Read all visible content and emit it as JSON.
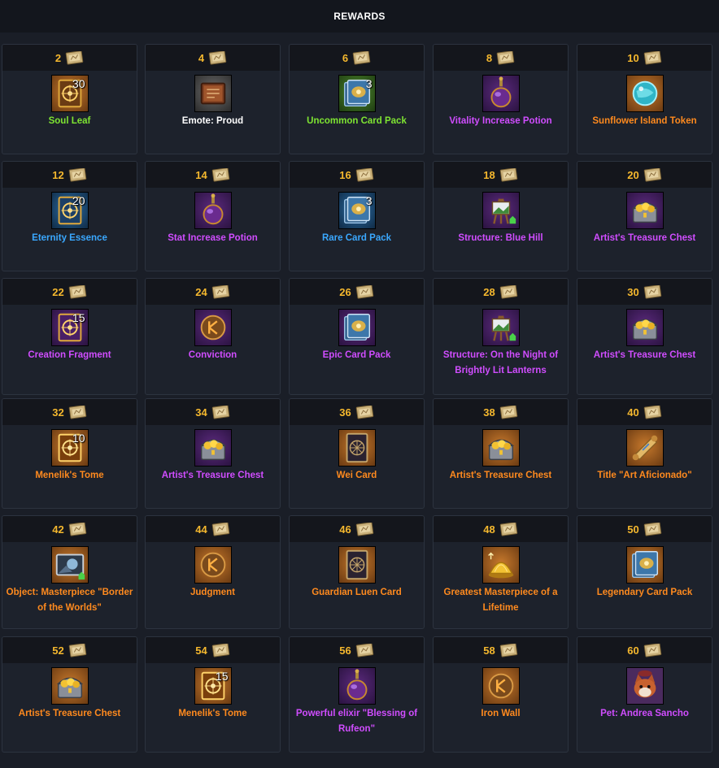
{
  "header": {
    "title": "REWARDS"
  },
  "rewards": [
    {
      "level": "2",
      "qty": "30",
      "label": "Soul Leaf",
      "quality": "green",
      "icon": "soul-leaf-icon"
    },
    {
      "level": "4",
      "qty": "",
      "label": "Emote: Proud",
      "quality": "white",
      "icon": "emote-book-icon"
    },
    {
      "level": "6",
      "qty": "3",
      "label": "Uncommon Card Pack",
      "quality": "green",
      "icon": "card-pack-icon"
    },
    {
      "level": "8",
      "qty": "",
      "label": "Vitality Increase Potion",
      "quality": "purple",
      "icon": "potion-icon"
    },
    {
      "level": "10",
      "qty": "",
      "label": "Sunflower Island Token",
      "quality": "orange",
      "icon": "token-orb-icon"
    },
    {
      "level": "12",
      "qty": "20",
      "label": "Eternity Essence",
      "quality": "blue",
      "icon": "essence-card-icon"
    },
    {
      "level": "14",
      "qty": "",
      "label": "Stat Increase Potion",
      "quality": "purple",
      "icon": "potion-icon"
    },
    {
      "level": "16",
      "qty": "3",
      "label": "Rare Card Pack",
      "quality": "blue",
      "icon": "card-pack-icon"
    },
    {
      "level": "18",
      "qty": "",
      "label": "Structure: Blue Hill",
      "quality": "purple",
      "icon": "easel-icon"
    },
    {
      "level": "20",
      "qty": "",
      "label": "Artist's Treasure Chest",
      "quality": "purple",
      "icon": "treasure-chest-icon"
    },
    {
      "level": "22",
      "qty": "15",
      "label": "Creation Fragment",
      "quality": "purple",
      "icon": "fragment-card-icon"
    },
    {
      "level": "24",
      "qty": "",
      "label": "Conviction",
      "quality": "purple",
      "icon": "rune-icon"
    },
    {
      "level": "26",
      "qty": "",
      "label": "Epic Card Pack",
      "quality": "purple",
      "icon": "card-pack-icon"
    },
    {
      "level": "28",
      "qty": "",
      "label": "Structure: On the Night of Brightly Lit Lanterns",
      "quality": "purple",
      "icon": "easel-icon"
    },
    {
      "level": "30",
      "qty": "",
      "label": "Artist's Treasure Chest",
      "quality": "purple",
      "icon": "treasure-chest-icon"
    },
    {
      "level": "32",
      "qty": "10",
      "label": "Menelik's Tome",
      "quality": "orange",
      "icon": "tome-icon"
    },
    {
      "level": "34",
      "qty": "",
      "label": "Artist's Treasure Chest",
      "quality": "purple",
      "icon": "treasure-chest-icon"
    },
    {
      "level": "36",
      "qty": "",
      "label": "Wei Card",
      "quality": "orange",
      "icon": "tarot-card-icon"
    },
    {
      "level": "38",
      "qty": "",
      "label": "Artist's Treasure Chest",
      "quality": "orange",
      "icon": "treasure-chest-icon"
    },
    {
      "level": "40",
      "qty": "",
      "label": "Title \"Art Aficionado\"",
      "quality": "orange",
      "icon": "scroll-icon"
    },
    {
      "level": "42",
      "qty": "",
      "label": "Object: Masterpiece \"Border of the Worlds\"",
      "quality": "orange",
      "icon": "painting-icon"
    },
    {
      "level": "44",
      "qty": "",
      "label": "Judgment",
      "quality": "orange",
      "icon": "rune-icon"
    },
    {
      "level": "46",
      "qty": "",
      "label": "Guardian Luen Card",
      "quality": "orange",
      "icon": "tarot-card-icon"
    },
    {
      "level": "48",
      "qty": "",
      "label": "Greatest Masterpiece of a Lifetime",
      "quality": "orange",
      "icon": "golden-dome-icon"
    },
    {
      "level": "50",
      "qty": "",
      "label": "Legendary Card Pack",
      "quality": "orange",
      "icon": "card-pack-icon"
    },
    {
      "level": "52",
      "qty": "",
      "label": "Artist's Treasure Chest",
      "quality": "orange",
      "icon": "treasure-chest-icon"
    },
    {
      "level": "54",
      "qty": "15",
      "label": "Menelik's Tome",
      "quality": "orange",
      "icon": "tome-icon"
    },
    {
      "level": "56",
      "qty": "",
      "label": "Powerful elixir \"Blessing of Rufeon\"",
      "quality": "purple",
      "icon": "potion-icon"
    },
    {
      "level": "58",
      "qty": "",
      "label": "Iron Wall",
      "quality": "orange",
      "icon": "rune-icon"
    },
    {
      "level": "60",
      "qty": "",
      "label": "Pet: Andrea Sancho",
      "quality": "purple",
      "icon": "pet-portrait-icon"
    }
  ]
}
